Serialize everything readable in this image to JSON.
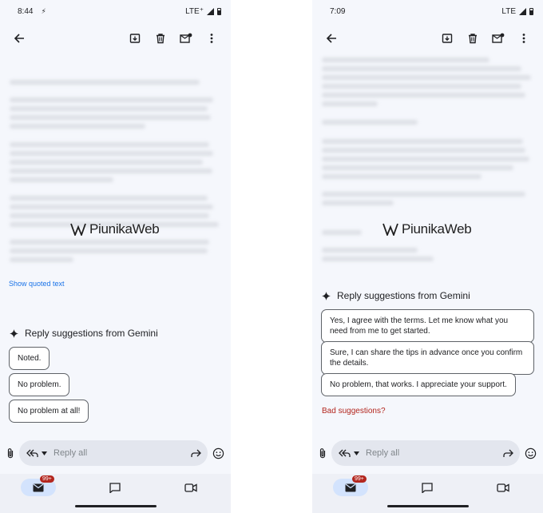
{
  "left": {
    "status": {
      "time": "8:44",
      "network": "LTE⁺"
    },
    "show_quoted": "Show quoted text",
    "gemini_title": "Reply suggestions from Gemini",
    "chips": [
      "Noted.",
      "No problem.",
      "No problem at all!"
    ],
    "reply_placeholder": "Reply all",
    "badge": "99+"
  },
  "right": {
    "status": {
      "time": "7:09",
      "network": "LTE"
    },
    "gemini_title": "Reply suggestions from Gemini",
    "chips": [
      "Yes, I agree with the terms. Let me know what you need from me to get started.",
      "Sure, I can share the tips in advance once you confirm the details.",
      "No problem, that works. I appreciate your support."
    ],
    "bad_suggestions": "Bad suggestions?",
    "reply_placeholder": "Reply all",
    "badge": "99+"
  },
  "watermark": "PiunikaWeb",
  "colors": {
    "accent_link": "#1a73e8",
    "badge_red": "#b3261e",
    "active_nav": "#d3e3fd"
  },
  "icons": [
    "back-arrow-icon",
    "archive-icon",
    "delete-icon",
    "mark-unread-icon",
    "more-vert-icon",
    "gemini-sparkle-icon",
    "attach-icon",
    "reply-all-icon",
    "forward-icon",
    "emoji-icon",
    "mail-icon",
    "chat-icon",
    "meet-icon"
  ]
}
